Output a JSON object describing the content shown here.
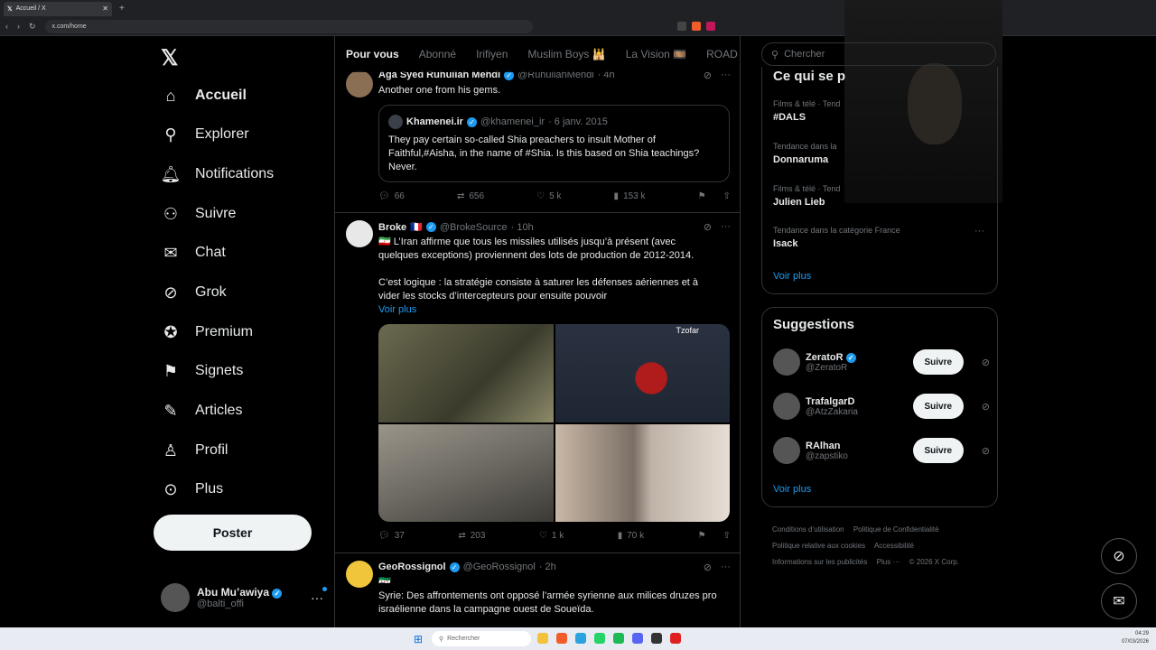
{
  "browser": {
    "tab_title": "Accueil / X",
    "url": "x.com/home"
  },
  "nav": {
    "items": [
      {
        "label": "Accueil",
        "icon": "home-icon"
      },
      {
        "label": "Explorer",
        "icon": "search-icon"
      },
      {
        "label": "Notifications",
        "icon": "bell-icon"
      },
      {
        "label": "Suivre",
        "icon": "person-add-icon"
      },
      {
        "label": "Chat",
        "icon": "mail-icon"
      },
      {
        "label": "Grok",
        "icon": "grok-icon"
      },
      {
        "label": "Premium",
        "icon": "verified-badge-icon"
      },
      {
        "label": "Signets",
        "icon": "bookmark-icon"
      },
      {
        "label": "Articles",
        "icon": "article-icon"
      },
      {
        "label": "Profil",
        "icon": "profile-icon"
      },
      {
        "label": "Plus",
        "icon": "more-circle-icon"
      }
    ],
    "post_button": "Poster",
    "user_name": "Abu Mu’awiya",
    "user_handle": "@balti_offi"
  },
  "feed": {
    "tabs": [
      "Pour vous",
      "Abonné",
      "Irifiyen",
      "Muslim Boys 🕌",
      "La Vision 🎞️",
      "ROAD"
    ],
    "post1": {
      "name": "Aga Syed Ruhullah Mehdi",
      "handle": "@RuhullahMehdi",
      "time": "· 4h",
      "text": "Another one  from his gems.",
      "quote_name": "Khamenei.ir",
      "quote_handle": "@khamenei_ir",
      "quote_time": "· 6 janv. 2015",
      "quote_text": "They pay certain so-called Shia preachers to insult Mother of Faithful,#Aisha, in the name of #Shia. Is this based on Shia teachings? Never.",
      "replies": "66",
      "reposts": "656",
      "likes": "5 k",
      "views": "153 k"
    },
    "post2": {
      "name": "Broke",
      "handle": "@BrokeSource",
      "time": "· 10h",
      "text1": "🇮🇷 L’Iran affirme que tous les missiles utilisés jusqu’à présent (avec quelques exceptions) proviennent des lots de production de 2012-2014.",
      "text2": "C’est logique : la stratégie consiste à saturer les défenses aériennes et à vider les stocks d’intercepteurs pour ensuite pouvoir",
      "more": "Voir plus",
      "map_label": "Tzofar",
      "replies": "37",
      "reposts": "203",
      "likes": "1 k",
      "views": "70 k"
    },
    "post3": {
      "name": "GeoRossignol",
      "handle": "@GeoRossignol",
      "time": "· 2h",
      "flag": "🇸🇾",
      "text": "Syrie: Des affrontements ont opposé l’armée syrienne aux milices druzes pro israélienne dans la campagne ouest de Soueïda."
    }
  },
  "right": {
    "search_placeholder": "Chercher",
    "trends_title": "Ce qui se p",
    "trends": [
      {
        "context": "Films & télé · Tend",
        "name": "#DALS"
      },
      {
        "context": "Tendance dans la",
        "name": "Donnaruma"
      },
      {
        "context": "Films & télé · Tend",
        "name": "Julien Lieb"
      },
      {
        "context": "Tendance dans la catégorie France",
        "name": "Isack"
      }
    ],
    "trends_more": "Voir plus",
    "suggestions_title": "Suggestions",
    "suggestions": [
      {
        "name": "ZeratoR",
        "handle": "@ZeratoR",
        "button": "Suivre"
      },
      {
        "name": "TrafalgarD",
        "handle": "@AtzZakaria",
        "button": "Suivre"
      },
      {
        "name": "RAlhan",
        "handle": "@zapstiko",
        "button": "Suivre"
      }
    ],
    "suggestions_more": "Voir plus",
    "footer": [
      "Conditions d’utilisation",
      "Politique de Confidentialité",
      "Politique relative aux cookies",
      "Accessibilité",
      "Informations sur les publicités",
      "Plus ···",
      "© 2026 X Corp."
    ]
  },
  "taskbar": {
    "search": "Rechercher",
    "time": "04:29",
    "date": "07/03/2026"
  }
}
